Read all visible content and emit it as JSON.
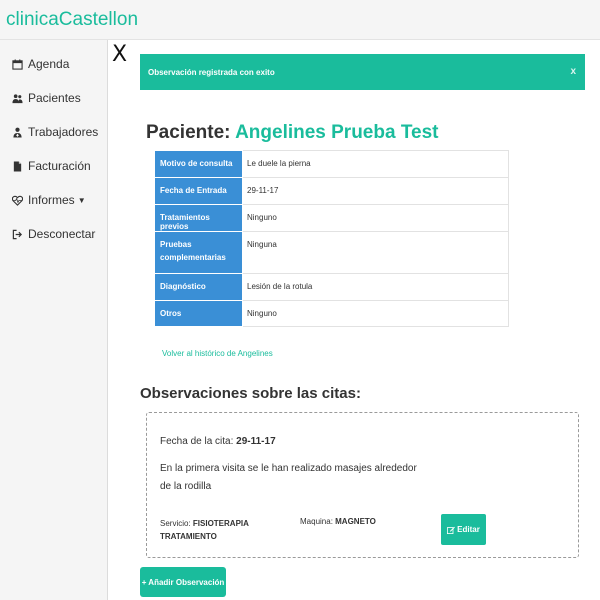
{
  "app": {
    "brand": "clinicaCastellon"
  },
  "sidebar": {
    "items": [
      {
        "label": "Agenda",
        "icon": "calendar-icon"
      },
      {
        "label": "Pacientes",
        "icon": "users-icon"
      },
      {
        "label": "Trabajadores",
        "icon": "user-md-icon"
      },
      {
        "label": "Facturación",
        "icon": "file-icon"
      },
      {
        "label": "Informes",
        "icon": "heartbeat-icon"
      },
      {
        "label": "Desconectar",
        "icon": "sign-out-icon"
      }
    ]
  },
  "close": {
    "label": "X"
  },
  "alert": {
    "message": "Observación registrada con exito",
    "close_label": "x"
  },
  "patient": {
    "prefix": "Paciente: ",
    "name": "Angelines Prueba Test",
    "fields": [
      {
        "label": "Motivo de consulta",
        "value": "Le duele la pierna"
      },
      {
        "label": "Fecha de Entrada",
        "value": "29-11-17"
      },
      {
        "label": "Tratamientos previos",
        "value": "Ninguno"
      },
      {
        "label": "Pruebas complementarias",
        "value": "Ninguna"
      },
      {
        "label": "Diagnóstico",
        "value": "Lesión de la rotula"
      },
      {
        "label": "Otros",
        "value": "Ninguno"
      }
    ]
  },
  "back_link": "Volver al histórico de Angelines",
  "observations": {
    "title": "Observaciones sobre las citas:",
    "items": [
      {
        "date_label": "Fecha de la cita: ",
        "date": "29-11-17",
        "text": "En la primera visita se le han realizado masajes alrededor de la rodilla",
        "servicio_label": "Servicio: ",
        "servicio": "FISIOTERAPIA TRATAMIENTO",
        "maquina_label": "Maquina: ",
        "maquina": "MAGNETO",
        "edit_label": "Editar"
      }
    ]
  },
  "add_button": "+ Añadir Observación",
  "colors": {
    "accent": "#1abc9c",
    "label_bg": "#3a8fd6"
  }
}
